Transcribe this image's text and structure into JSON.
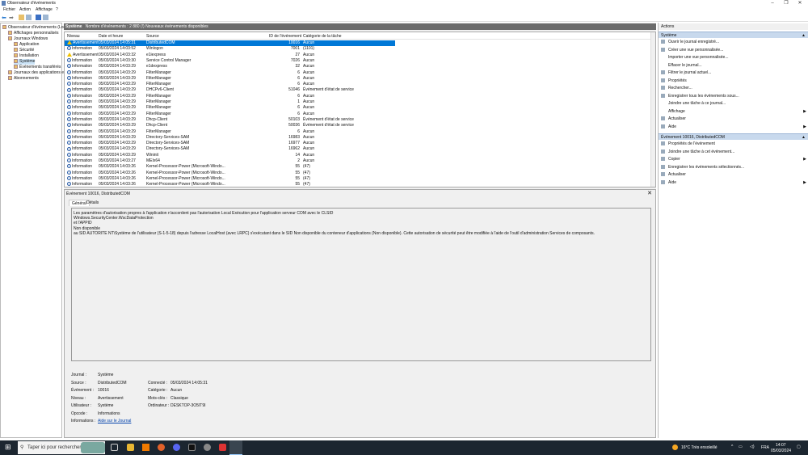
{
  "window": {
    "title": "Observateur d'événements"
  },
  "menu": [
    "Fichier",
    "Action",
    "Affichage",
    "?"
  ],
  "tree": [
    {
      "label": "Observateur d'événements (Local)",
      "indent": 0
    },
    {
      "label": "Affichages personnalisés",
      "indent": 1
    },
    {
      "label": "Journaux Windows",
      "indent": 1
    },
    {
      "label": "Application",
      "indent": 2
    },
    {
      "label": "Sécurité",
      "indent": 2
    },
    {
      "label": "Installation",
      "indent": 2
    },
    {
      "label": "Système",
      "indent": 2,
      "selected": true
    },
    {
      "label": "Événements transférés",
      "indent": 2
    },
    {
      "label": "Journaux des applications et",
      "indent": 1
    },
    {
      "label": "Abonnements",
      "indent": 1
    }
  ],
  "header": {
    "log": "Système",
    "info": "Nombre d'événements : 2 880 (!) Nouveaux événements disponibles"
  },
  "columns": [
    "Niveau",
    "Date et heure",
    "Source",
    "ID de l'événement",
    "Catégorie de la tâche"
  ],
  "events": [
    [
      "Avertissement",
      "05/03/2024 14:05:31",
      "DistributedCOM",
      "10016",
      "Aucun"
    ],
    [
      "Information",
      "05/03/2024 14:03:52",
      "Winlogon",
      "7001",
      "(1101)"
    ],
    [
      "Avertissement",
      "05/03/2024 14:03:32",
      "e1iexpress",
      "27",
      "Aucun"
    ],
    [
      "Information",
      "05/03/2024 14:03:30",
      "Service Control Manager",
      "7026",
      "Aucun"
    ],
    [
      "Information",
      "05/03/2024 14:03:29",
      "e1dexpress",
      "32",
      "Aucun"
    ],
    [
      "Information",
      "05/03/2024 14:03:29",
      "FilterManager",
      "6",
      "Aucun"
    ],
    [
      "Information",
      "05/03/2024 14:03:29",
      "FilterManager",
      "6",
      "Aucun"
    ],
    [
      "Information",
      "05/03/2024 14:03:29",
      "FilterManager",
      "6",
      "Aucun"
    ],
    [
      "Information",
      "05/03/2024 14:03:29",
      "DHCPv6-Client",
      "51046",
      "Événement d'état de service"
    ],
    [
      "Information",
      "05/03/2024 14:03:29",
      "FilterManager",
      "6",
      "Aucun"
    ],
    [
      "Information",
      "05/03/2024 14:03:29",
      "FilterManager",
      "1",
      "Aucun"
    ],
    [
      "Information",
      "05/03/2024 14:03:29",
      "FilterManager",
      "6",
      "Aucun"
    ],
    [
      "Information",
      "05/03/2024 14:03:29",
      "FilterManager",
      "6",
      "Aucun"
    ],
    [
      "Information",
      "05/03/2024 14:03:29",
      "Dhcp-Client",
      "50103",
      "Événement d'état de service"
    ],
    [
      "Information",
      "05/03/2024 14:03:29",
      "Dhcp-Client",
      "50036",
      "Événement d'état de service"
    ],
    [
      "Information",
      "05/03/2024 14:03:29",
      "FilterManager",
      "6",
      "Aucun"
    ],
    [
      "Information",
      "05/03/2024 14:03:29",
      "Directory-Services-SAM",
      "16983",
      "Aucun"
    ],
    [
      "Information",
      "05/03/2024 14:03:29",
      "Directory-Services-SAM",
      "16977",
      "Aucun"
    ],
    [
      "Information",
      "05/03/2024 14:03:29",
      "Directory-Services-SAM",
      "16962",
      "Aucun"
    ],
    [
      "Information",
      "05/03/2024 14:03:29",
      "Wininit",
      "14",
      "Aucun"
    ],
    [
      "Information",
      "05/03/2024 14:03:27",
      "MEIx64",
      "2",
      "Aucun"
    ],
    [
      "Information",
      "05/03/2024 14:03:26",
      "Kernel-Processor-Power (Microsoft-Windo...",
      "55",
      "(47)"
    ],
    [
      "Information",
      "05/03/2024 14:03:26",
      "Kernel-Processor-Power (Microsoft-Windo...",
      "55",
      "(47)"
    ],
    [
      "Information",
      "05/03/2024 14:03:26",
      "Kernel-Processor-Power (Microsoft-Windo...",
      "55",
      "(47)"
    ],
    [
      "Information",
      "05/03/2024 14:03:26",
      "Kernel-Processor-Power (Microsoft-Windo...",
      "55",
      "(47)"
    ]
  ],
  "detail": {
    "title": "Événement 10016, DistributedCOM",
    "tabs": [
      "Général",
      "Détails"
    ],
    "message": [
      "Les paramètres d'autorisation propres à l'application n'accordent pas l'autorisation Local Exécution pour l'application serveur COM avec le CLSID",
      "Windows.SecurityCenter.WscDataProtection",
      " et l'APPID",
      "Non disponible",
      " au SID AUTORITE NT\\Système de l'utilisateur (S-1-5-18) depuis l'adresse LocalHost (avec LRPC) s'exécutant dans le SID Non disponible du conteneur d'applications (Non disponible). Cette autorisation de sécurité peut être modifiée à l'aide de l'outil d'administration Services de composants."
    ],
    "fields": {
      "journal_label": "Journal :",
      "journal": "Système",
      "source_label": "Source :",
      "source": "DistributedCOM",
      "connecte_label": "Connecté :",
      "connecte": "05/03/2024 14:05:31",
      "evenement_label": "Événement :",
      "evenement": "10016",
      "categorie_label": "Catégorie :",
      "categorie": "Aucun",
      "niveau_label": "Niveau :",
      "niveau": "Avertissement",
      "motscles_label": "Mots-clés :",
      "motscles": "Classique",
      "utilisateur_label": "Utilisateur :",
      "utilisateur": "Système",
      "ordinateur_label": "Ordinateur :",
      "ordinateur": "DESKTOP-3O5IT9I",
      "opcode_label": "Opcode :",
      "opcode": "Informations",
      "informations_label": "Informations :",
      "informations": "Aide sur le Journal"
    }
  },
  "actions": {
    "title": "Actions",
    "section1": "Système",
    "items1": [
      {
        "label": "Ouvrir le journal enregistré...",
        "icon": "folder-icon"
      },
      {
        "label": "Créer une vue personnalisée...",
        "icon": "filter-icon"
      },
      {
        "label": "Importer une vue personnalisée...",
        "icon": ""
      },
      {
        "label": "Effacer le journal...",
        "icon": ""
      },
      {
        "label": "Filtrer le journal actuel...",
        "icon": "filter-icon"
      },
      {
        "label": "Propriétés",
        "icon": "properties-icon"
      },
      {
        "label": "Rechercher...",
        "icon": "find-icon"
      },
      {
        "label": "Enregistrer tous les événements sous...",
        "icon": "save-icon"
      },
      {
        "label": "Joindre une tâche à ce journal...",
        "icon": ""
      },
      {
        "label": "Affichage",
        "icon": "",
        "submenu": true
      },
      {
        "label": "Actualiser",
        "icon": "refresh-icon"
      },
      {
        "label": "Aide",
        "icon": "help-icon",
        "submenu": true
      }
    ],
    "section2": "Événement 10016, DistributedCOM",
    "items2": [
      {
        "label": "Propriétés de l'événement",
        "icon": "properties-icon"
      },
      {
        "label": "Joindre une tâche à cet événement...",
        "icon": "task-icon"
      },
      {
        "label": "Copier",
        "icon": "copy-icon",
        "submenu": true
      },
      {
        "label": "Enregistrer les événements sélectionnés...",
        "icon": "save-icon"
      },
      {
        "label": "Actualiser",
        "icon": "refresh-icon"
      },
      {
        "label": "Aide",
        "icon": "help-icon",
        "submenu": true
      }
    ]
  },
  "taskbar": {
    "search_placeholder": "Taper ici pour rechercher",
    "weather": "16°C  Très ensoleillé",
    "lang": "FRA",
    "time": "14:07",
    "date": "05/03/2024"
  },
  "colors": {
    "selection": "#0078d7",
    "section": "#c8d9ed",
    "taskbar": "#1c2630"
  }
}
